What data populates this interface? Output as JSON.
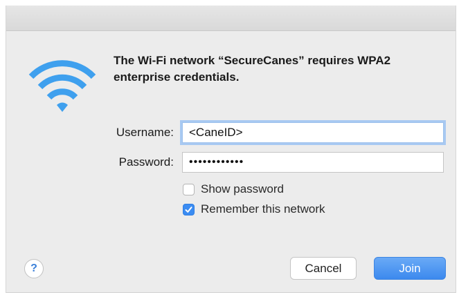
{
  "dialog": {
    "message": "The Wi-Fi network “SecureCanes” requires WPA2 enterprise credentials.",
    "icon": "wifi-icon"
  },
  "form": {
    "username_label": "Username:",
    "username_value": "<CaneID>",
    "password_label": "Password:",
    "password_value": "••••••••••••",
    "show_password_label": "Show password",
    "show_password_checked": false,
    "remember_label": "Remember this network",
    "remember_checked": true
  },
  "buttons": {
    "help_label": "?",
    "cancel_label": "Cancel",
    "join_label": "Join"
  },
  "colors": {
    "accent": "#3b8cf2",
    "wifi": "#3fa0ee"
  }
}
